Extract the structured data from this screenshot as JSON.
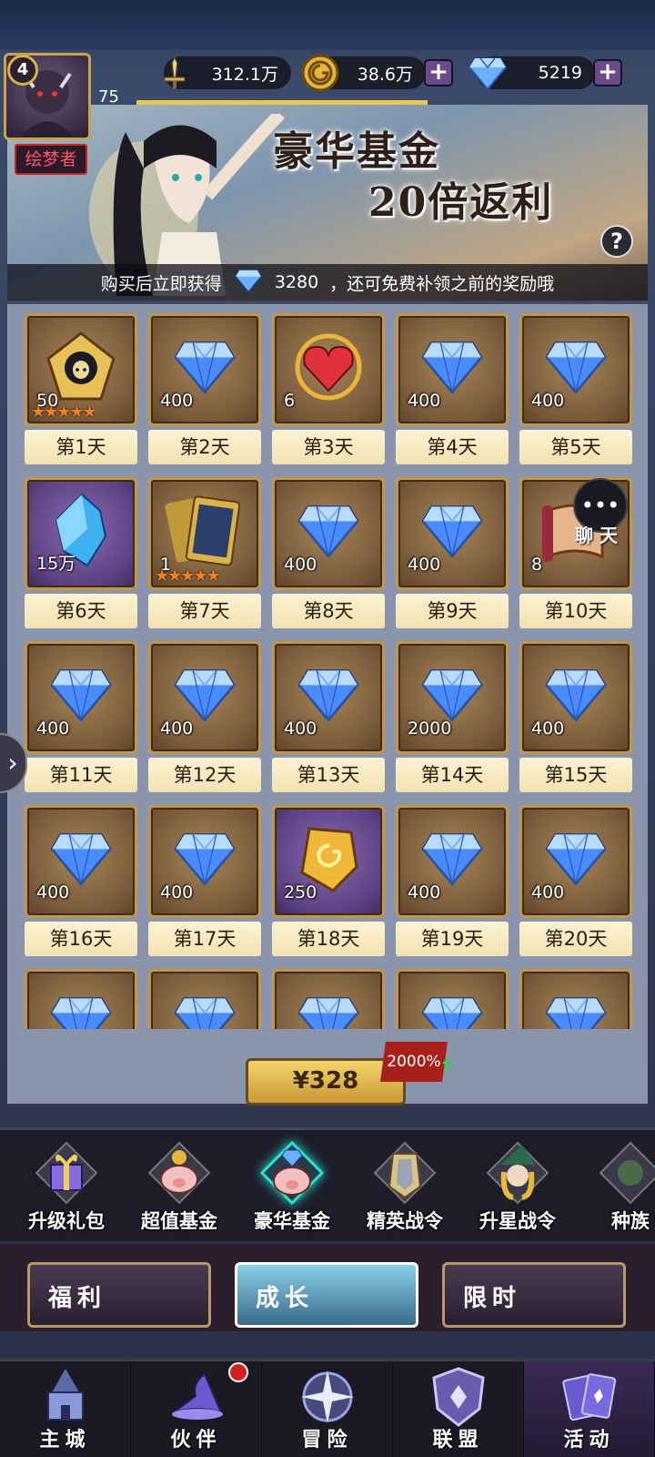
{
  "header": {
    "level": "4",
    "exp_value": "75",
    "title_tag": "绘梦者",
    "power": "312.1万",
    "gold": "38.6万",
    "diamonds": "5219"
  },
  "banner": {
    "title_line1": "豪华基金",
    "title_line2": "20倍返利",
    "help": "?",
    "sub_prefix": "购买后立即获得",
    "sub_amount": "3280",
    "sub_suffix": "，还可免费补领之前的奖励哦"
  },
  "rewards": [
    {
      "day": "第1天",
      "qty": "50",
      "icon": "hero-portrait-icon",
      "stars": "★★★★★",
      "frame": "gold"
    },
    {
      "day": "第2天",
      "qty": "400",
      "icon": "diamond-icon",
      "frame": "gold"
    },
    {
      "day": "第3天",
      "qty": "6",
      "icon": "red-heart-gem-icon",
      "frame": "gold"
    },
    {
      "day": "第4天",
      "qty": "400",
      "icon": "diamond-icon",
      "frame": "gold"
    },
    {
      "day": "第5天",
      "qty": "400",
      "icon": "diamond-icon",
      "frame": "gold"
    },
    {
      "day": "第6天",
      "qty": "15万",
      "icon": "blue-crystal-icon",
      "frame": "purple"
    },
    {
      "day": "第7天",
      "qty": "1",
      "icon": "card-pack-icon",
      "stars": "★★★★★",
      "frame": "gold"
    },
    {
      "day": "第8天",
      "qty": "400",
      "icon": "diamond-icon",
      "frame": "gold"
    },
    {
      "day": "第9天",
      "qty": "400",
      "icon": "diamond-icon",
      "frame": "gold"
    },
    {
      "day": "第10天",
      "qty": "8",
      "icon": "scroll-icon",
      "frame": "gold"
    },
    {
      "day": "第11天",
      "qty": "400",
      "icon": "diamond-icon",
      "frame": "gold"
    },
    {
      "day": "第12天",
      "qty": "400",
      "icon": "diamond-icon",
      "frame": "gold"
    },
    {
      "day": "第13天",
      "qty": "400",
      "icon": "diamond-icon",
      "frame": "gold"
    },
    {
      "day": "第14天",
      "qty": "2000",
      "icon": "diamond-icon",
      "frame": "gold"
    },
    {
      "day": "第15天",
      "qty": "400",
      "icon": "diamond-icon",
      "frame": "gold"
    },
    {
      "day": "第16天",
      "qty": "400",
      "icon": "diamond-icon",
      "frame": "gold"
    },
    {
      "day": "第17天",
      "qty": "400",
      "icon": "diamond-icon",
      "frame": "gold"
    },
    {
      "day": "第18天",
      "qty": "250",
      "icon": "gold-ore-icon",
      "frame": "purple"
    },
    {
      "day": "第19天",
      "qty": "400",
      "icon": "diamond-icon",
      "frame": "gold"
    },
    {
      "day": "第20天",
      "qty": "400",
      "icon": "diamond-icon",
      "frame": "gold"
    },
    {
      "day": "",
      "qty": "",
      "icon": "diamond-icon",
      "frame": "gold"
    },
    {
      "day": "",
      "qty": "",
      "icon": "diamond-icon",
      "frame": "gold"
    },
    {
      "day": "",
      "qty": "",
      "icon": "diamond-icon",
      "frame": "gold"
    },
    {
      "day": "",
      "qty": "",
      "icon": "diamond-icon",
      "frame": "gold"
    },
    {
      "day": "",
      "qty": "",
      "icon": "diamond-icon",
      "frame": "gold"
    }
  ],
  "chat": {
    "label": "聊 天"
  },
  "purchase": {
    "price": "¥328",
    "bonus": "2000%"
  },
  "categories": [
    {
      "label": "升级礼包",
      "icon": "gift-box-icon",
      "active": false
    },
    {
      "label": "超值基金",
      "icon": "piggy-bank-icon",
      "active": false
    },
    {
      "label": "豪华基金",
      "icon": "piggy-bank-diamond-icon",
      "active": true
    },
    {
      "label": "精英战令",
      "icon": "shield-scroll-icon",
      "active": false
    },
    {
      "label": "升星战令",
      "icon": "witch-portrait-icon",
      "active": false
    },
    {
      "label": "种族",
      "icon": "race-icon",
      "active": false
    }
  ],
  "midnav": [
    {
      "label": "福利",
      "active": false
    },
    {
      "label": "成长",
      "active": true
    },
    {
      "label": "限时",
      "active": false
    }
  ],
  "bottomnav": [
    {
      "label": "主城",
      "icon": "castle-icon",
      "active": false
    },
    {
      "label": "伙伴",
      "icon": "wizard-hat-icon",
      "active": false
    },
    {
      "label": "冒险",
      "icon": "compass-star-icon",
      "active": false
    },
    {
      "label": "联盟",
      "icon": "alliance-shield-icon",
      "active": false
    },
    {
      "label": "活动",
      "icon": "cards-icon",
      "active": true
    }
  ],
  "colors": {
    "accent_gold": "#c49642",
    "active_teal": "#28e2d0",
    "badge_red": "#d81f1f"
  }
}
